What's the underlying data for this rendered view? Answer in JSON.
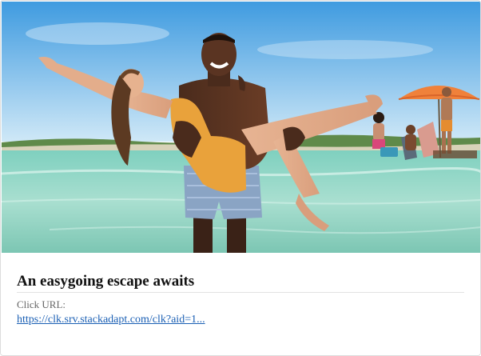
{
  "ad": {
    "headline": "An easygoing escape awaits",
    "click_label": "Click URL:",
    "click_url": "https://clk.srv.stackadapt.com/clk?aid=1..."
  },
  "image": {
    "alt": "",
    "colors": {
      "sky_top": "#4aa3e0",
      "sky_bottom": "#c8e4f5",
      "water": "#8fd4c2",
      "swimsuit": "#e9a23b",
      "umbrella": "#f0813a",
      "shorts": "#8aa4c4"
    }
  }
}
